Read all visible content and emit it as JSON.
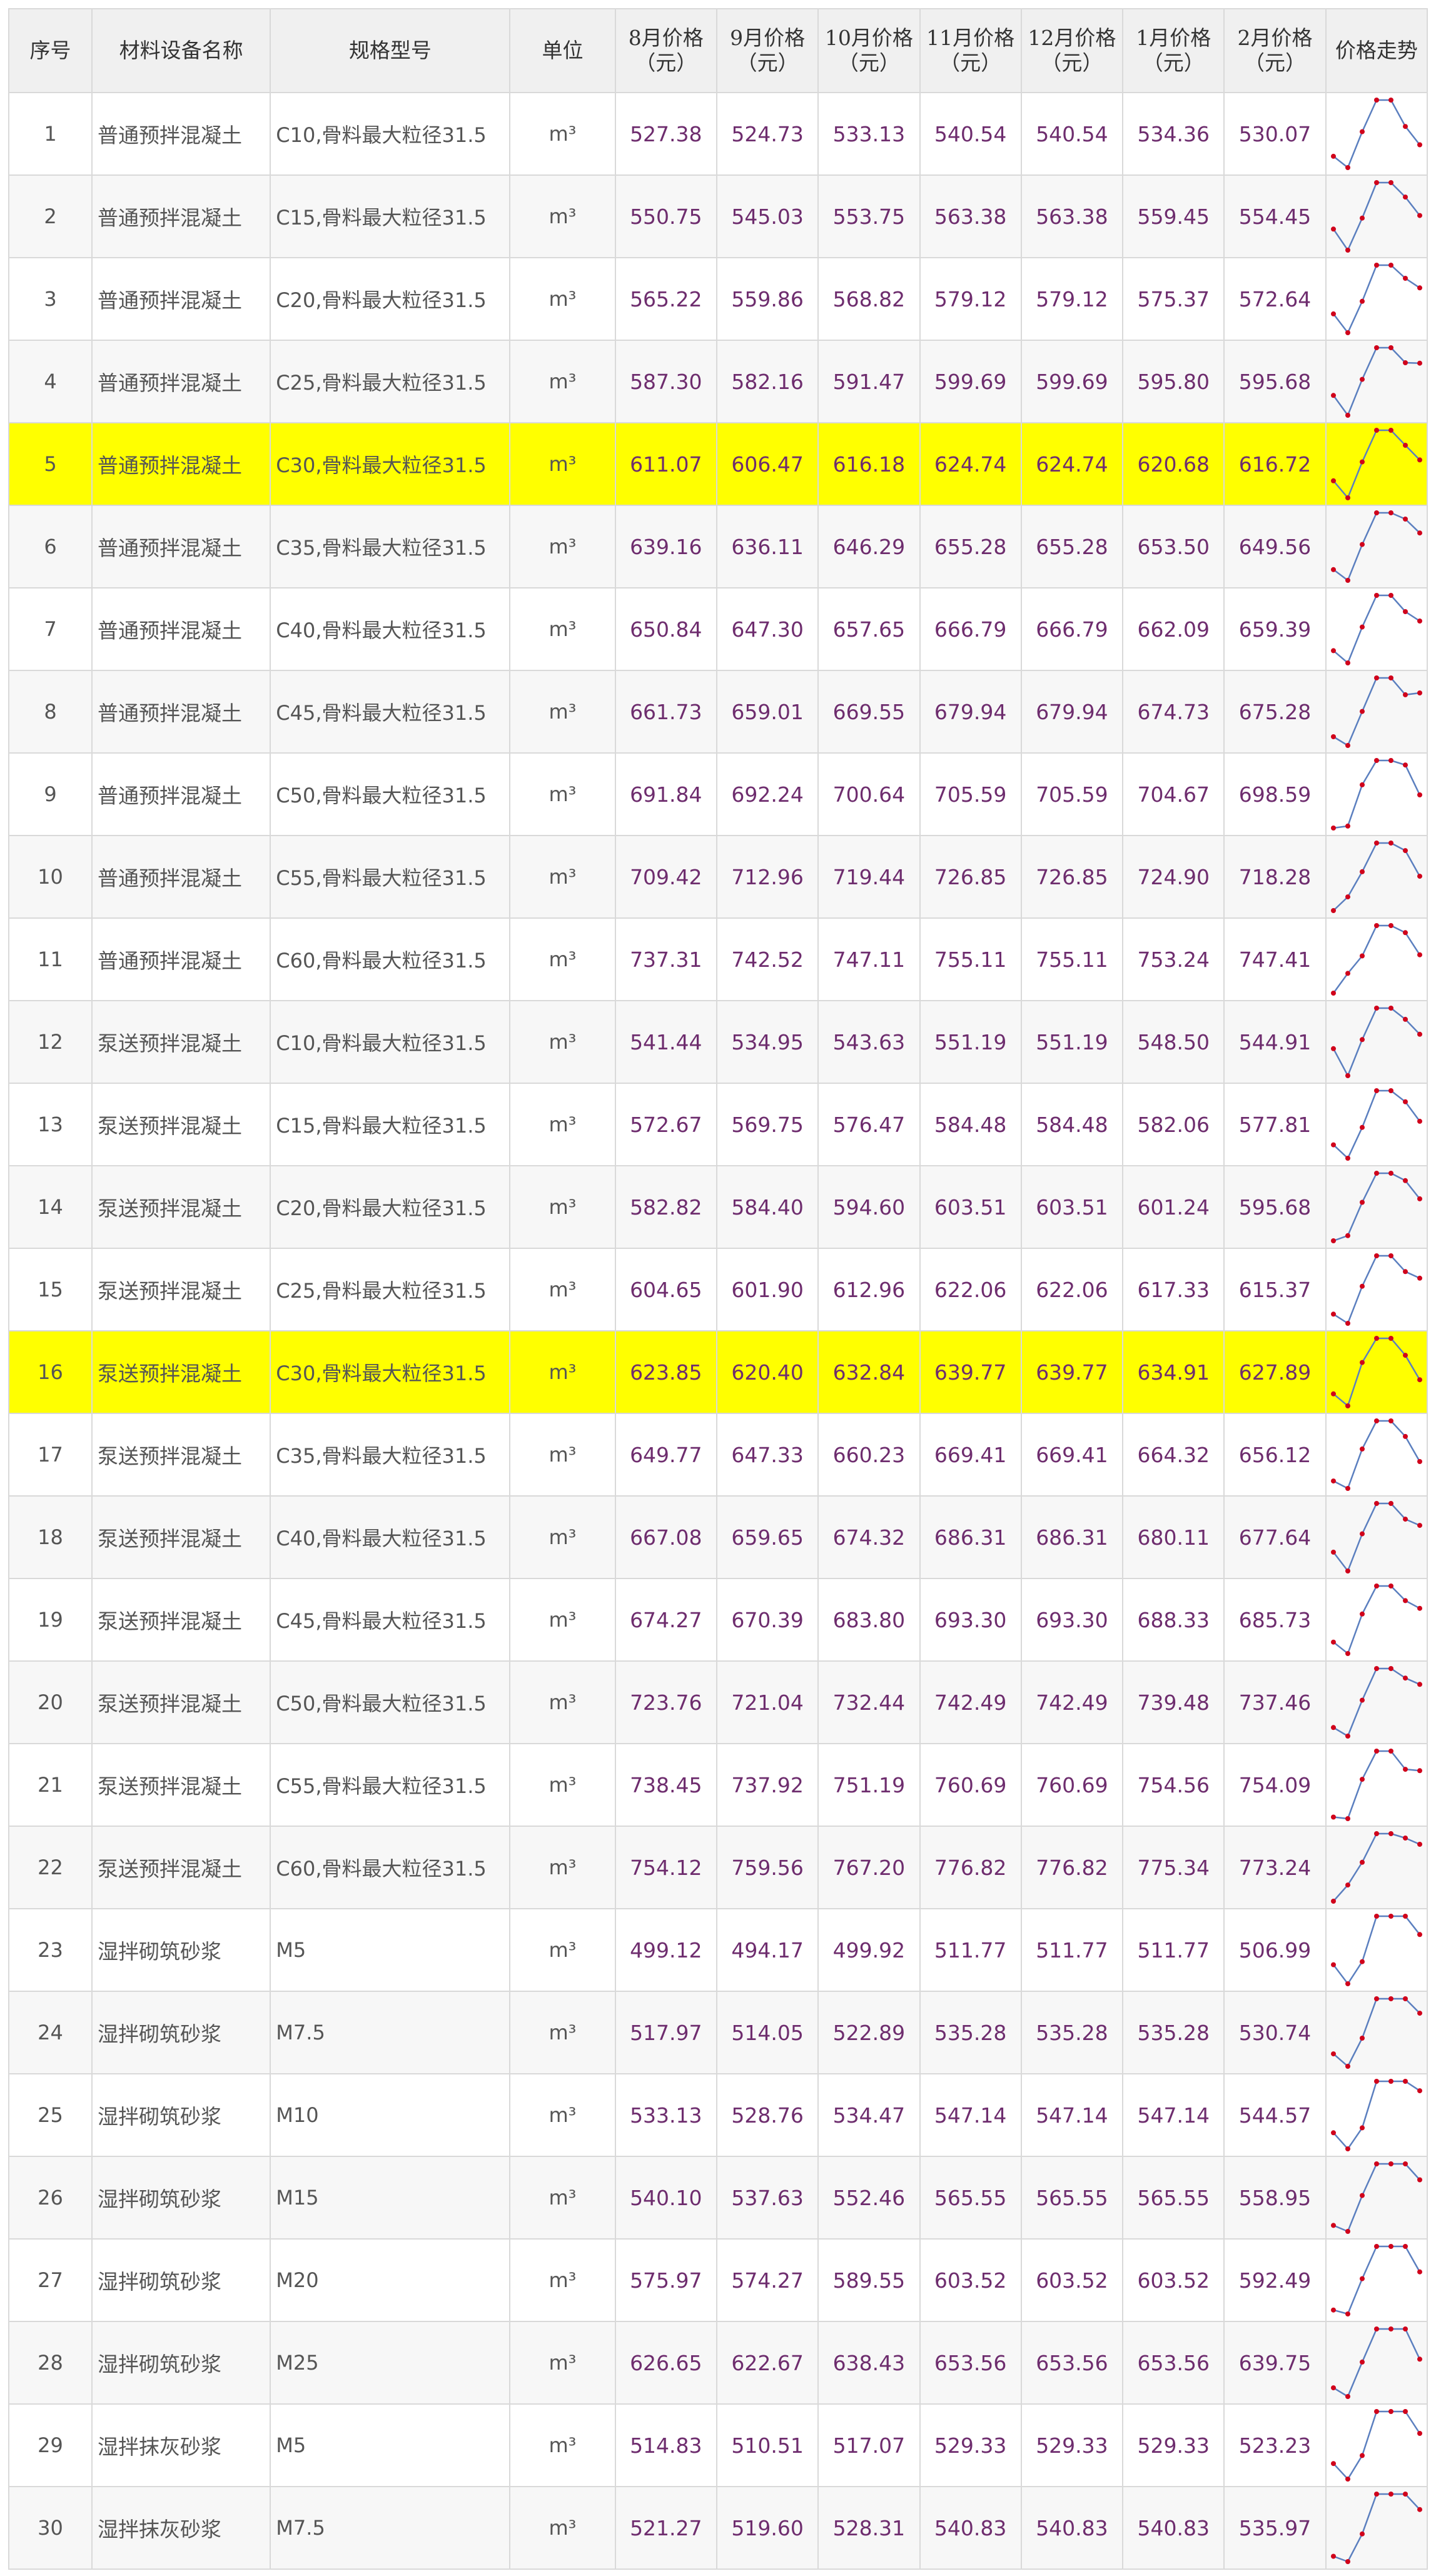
{
  "headers": [
    "序号",
    "材料设备名称",
    "规格型号",
    "单位",
    "8月价格（元）",
    "9月价格（元）",
    "10月价格（元）",
    "11月价格（元）",
    "12月价格（元）",
    "1月价格（元）",
    "2月价格（元）",
    "价格走势"
  ],
  "trend_colors": {
    "line": "#5b7fbf",
    "marker": "#d0021b"
  },
  "highlight_color": "#ffff00",
  "rows": [
    {
      "seq": "1",
      "name": "普通预拌混凝土",
      "spec": "C10,骨料最大粒径31.5",
      "unit": "m³",
      "prices": [
        "527.38",
        "524.73",
        "533.13",
        "540.54",
        "540.54",
        "534.36",
        "530.07"
      ],
      "highlight": false
    },
    {
      "seq": "2",
      "name": "普通预拌混凝土",
      "spec": "C15,骨料最大粒径31.5",
      "unit": "m³",
      "prices": [
        "550.75",
        "545.03",
        "553.75",
        "563.38",
        "563.38",
        "559.45",
        "554.45"
      ],
      "highlight": false
    },
    {
      "seq": "3",
      "name": "普通预拌混凝土",
      "spec": "C20,骨料最大粒径31.5",
      "unit": "m³",
      "prices": [
        "565.22",
        "559.86",
        "568.82",
        "579.12",
        "579.12",
        "575.37",
        "572.64"
      ],
      "highlight": false
    },
    {
      "seq": "4",
      "name": "普通预拌混凝土",
      "spec": "C25,骨料最大粒径31.5",
      "unit": "m³",
      "prices": [
        "587.30",
        "582.16",
        "591.47",
        "599.69",
        "599.69",
        "595.80",
        "595.68"
      ],
      "highlight": false
    },
    {
      "seq": "5",
      "name": "普通预拌混凝土",
      "spec": "C30,骨料最大粒径31.5",
      "unit": "m³",
      "prices": [
        "611.07",
        "606.47",
        "616.18",
        "624.74",
        "624.74",
        "620.68",
        "616.72"
      ],
      "highlight": true
    },
    {
      "seq": "6",
      "name": "普通预拌混凝土",
      "spec": "C35,骨料最大粒径31.5",
      "unit": "m³",
      "prices": [
        "639.16",
        "636.11",
        "646.29",
        "655.28",
        "655.28",
        "653.50",
        "649.56"
      ],
      "highlight": false
    },
    {
      "seq": "7",
      "name": "普通预拌混凝土",
      "spec": "C40,骨料最大粒径31.5",
      "unit": "m³",
      "prices": [
        "650.84",
        "647.30",
        "657.65",
        "666.79",
        "666.79",
        "662.09",
        "659.39"
      ],
      "highlight": false
    },
    {
      "seq": "8",
      "name": "普通预拌混凝土",
      "spec": "C45,骨料最大粒径31.5",
      "unit": "m³",
      "prices": [
        "661.73",
        "659.01",
        "669.55",
        "679.94",
        "679.94",
        "674.73",
        "675.28"
      ],
      "highlight": false
    },
    {
      "seq": "9",
      "name": "普通预拌混凝土",
      "spec": "C50,骨料最大粒径31.5",
      "unit": "m³",
      "prices": [
        "691.84",
        "692.24",
        "700.64",
        "705.59",
        "705.59",
        "704.67",
        "698.59"
      ],
      "highlight": false
    },
    {
      "seq": "10",
      "name": "普通预拌混凝土",
      "spec": "C55,骨料最大粒径31.5",
      "unit": "m³",
      "prices": [
        "709.42",
        "712.96",
        "719.44",
        "726.85",
        "726.85",
        "724.90",
        "718.28"
      ],
      "highlight": false
    },
    {
      "seq": "11",
      "name": "普通预拌混凝土",
      "spec": "C60,骨料最大粒径31.5",
      "unit": "m³",
      "prices": [
        "737.31",
        "742.52",
        "747.11",
        "755.11",
        "755.11",
        "753.24",
        "747.41"
      ],
      "highlight": false
    },
    {
      "seq": "12",
      "name": "泵送预拌混凝土",
      "spec": "C10,骨料最大粒径31.5",
      "unit": "m³",
      "prices": [
        "541.44",
        "534.95",
        "543.63",
        "551.19",
        "551.19",
        "548.50",
        "544.91"
      ],
      "highlight": false
    },
    {
      "seq": "13",
      "name": "泵送预拌混凝土",
      "spec": "C15,骨料最大粒径31.5",
      "unit": "m³",
      "prices": [
        "572.67",
        "569.75",
        "576.47",
        "584.48",
        "584.48",
        "582.06",
        "577.81"
      ],
      "highlight": false
    },
    {
      "seq": "14",
      "name": "泵送预拌混凝土",
      "spec": "C20,骨料最大粒径31.5",
      "unit": "m³",
      "prices": [
        "582.82",
        "584.40",
        "594.60",
        "603.51",
        "603.51",
        "601.24",
        "595.68"
      ],
      "highlight": false
    },
    {
      "seq": "15",
      "name": "泵送预拌混凝土",
      "spec": "C25,骨料最大粒径31.5",
      "unit": "m³",
      "prices": [
        "604.65",
        "601.90",
        "612.96",
        "622.06",
        "622.06",
        "617.33",
        "615.37"
      ],
      "highlight": false
    },
    {
      "seq": "16",
      "name": "泵送预拌混凝土",
      "spec": "C30,骨料最大粒径31.5",
      "unit": "m³",
      "prices": [
        "623.85",
        "620.40",
        "632.84",
        "639.77",
        "639.77",
        "634.91",
        "627.89"
      ],
      "highlight": true
    },
    {
      "seq": "17",
      "name": "泵送预拌混凝土",
      "spec": "C35,骨料最大粒径31.5",
      "unit": "m³",
      "prices": [
        "649.77",
        "647.33",
        "660.23",
        "669.41",
        "669.41",
        "664.32",
        "656.12"
      ],
      "highlight": false
    },
    {
      "seq": "18",
      "name": "泵送预拌混凝土",
      "spec": "C40,骨料最大粒径31.5",
      "unit": "m³",
      "prices": [
        "667.08",
        "659.65",
        "674.32",
        "686.31",
        "686.31",
        "680.11",
        "677.64"
      ],
      "highlight": false
    },
    {
      "seq": "19",
      "name": "泵送预拌混凝土",
      "spec": "C45,骨料最大粒径31.5",
      "unit": "m³",
      "prices": [
        "674.27",
        "670.39",
        "683.80",
        "693.30",
        "693.30",
        "688.33",
        "685.73"
      ],
      "highlight": false
    },
    {
      "seq": "20",
      "name": "泵送预拌混凝土",
      "spec": "C50,骨料最大粒径31.5",
      "unit": "m³",
      "prices": [
        "723.76",
        "721.04",
        "732.44",
        "742.49",
        "742.49",
        "739.48",
        "737.46"
      ],
      "highlight": false
    },
    {
      "seq": "21",
      "name": "泵送预拌混凝土",
      "spec": "C55,骨料最大粒径31.5",
      "unit": "m³",
      "prices": [
        "738.45",
        "737.92",
        "751.19",
        "760.69",
        "760.69",
        "754.56",
        "754.09"
      ],
      "highlight": false
    },
    {
      "seq": "22",
      "name": "泵送预拌混凝土",
      "spec": "C60,骨料最大粒径31.5",
      "unit": "m³",
      "prices": [
        "754.12",
        "759.56",
        "767.20",
        "776.82",
        "776.82",
        "775.34",
        "773.24"
      ],
      "highlight": false
    },
    {
      "seq": "23",
      "name": "湿拌砌筑砂浆",
      "spec": "M5",
      "unit": "m³",
      "prices": [
        "499.12",
        "494.17",
        "499.92",
        "511.77",
        "511.77",
        "511.77",
        "506.99"
      ],
      "highlight": false
    },
    {
      "seq": "24",
      "name": "湿拌砌筑砂浆",
      "spec": "M7.5",
      "unit": "m³",
      "prices": [
        "517.97",
        "514.05",
        "522.89",
        "535.28",
        "535.28",
        "535.28",
        "530.74"
      ],
      "highlight": false
    },
    {
      "seq": "25",
      "name": "湿拌砌筑砂浆",
      "spec": "M10",
      "unit": "m³",
      "prices": [
        "533.13",
        "528.76",
        "534.47",
        "547.14",
        "547.14",
        "547.14",
        "544.57"
      ],
      "highlight": false
    },
    {
      "seq": "26",
      "name": "湿拌砌筑砂浆",
      "spec": "M15",
      "unit": "m³",
      "prices": [
        "540.10",
        "537.63",
        "552.46",
        "565.55",
        "565.55",
        "565.55",
        "558.95"
      ],
      "highlight": false
    },
    {
      "seq": "27",
      "name": "湿拌砌筑砂浆",
      "spec": "M20",
      "unit": "m³",
      "prices": [
        "575.97",
        "574.27",
        "589.55",
        "603.52",
        "603.52",
        "603.52",
        "592.49"
      ],
      "highlight": false
    },
    {
      "seq": "28",
      "name": "湿拌砌筑砂浆",
      "spec": "M25",
      "unit": "m³",
      "prices": [
        "626.65",
        "622.67",
        "638.43",
        "653.56",
        "653.56",
        "653.56",
        "639.75"
      ],
      "highlight": false
    },
    {
      "seq": "29",
      "name": "湿拌抹灰砂浆",
      "spec": "M5",
      "unit": "m³",
      "prices": [
        "514.83",
        "510.51",
        "517.07",
        "529.33",
        "529.33",
        "529.33",
        "523.23"
      ],
      "highlight": false
    },
    {
      "seq": "30",
      "name": "湿拌抹灰砂浆",
      "spec": "M7.5",
      "unit": "m³",
      "prices": [
        "521.27",
        "519.60",
        "528.31",
        "540.83",
        "540.83",
        "540.83",
        "535.97"
      ],
      "highlight": false
    }
  ]
}
